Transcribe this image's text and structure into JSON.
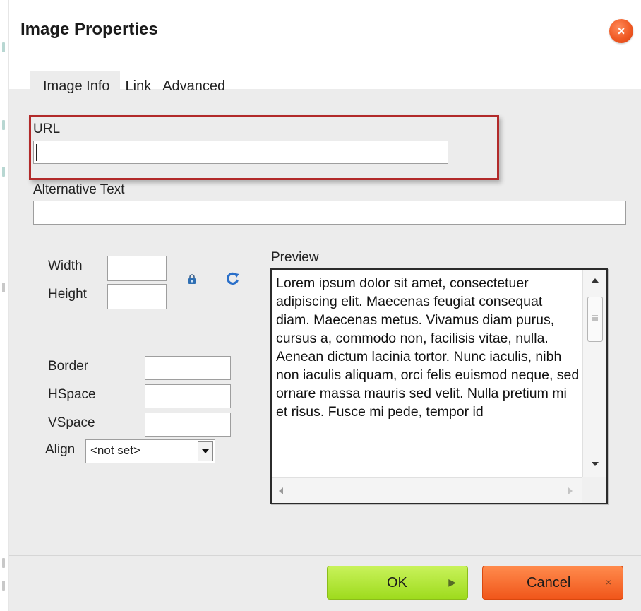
{
  "dialog": {
    "title": "Image Properties",
    "close_glyph": "×"
  },
  "tabs": [
    {
      "label": "Image Info",
      "active": true
    },
    {
      "label": "Link",
      "active": false
    },
    {
      "label": "Advanced",
      "active": false
    }
  ],
  "image_info": {
    "url_label": "URL",
    "url_value": "",
    "alt_label": "Alternative Text",
    "alt_value": "",
    "width_label": "Width",
    "width_value": "",
    "height_label": "Height",
    "height_value": "",
    "border_label": "Border",
    "border_value": "",
    "hspace_label": "HSpace",
    "hspace_value": "",
    "vspace_label": "VSpace",
    "vspace_value": "",
    "align_label": "Align",
    "align_selected": "<not set>",
    "preview_label": "Preview",
    "preview_text": "Lorem ipsum dolor sit amet, consectetuer adipiscing elit. Maecenas feugiat consequat diam. Maecenas metus. Vivamus diam purus, cursus a, commodo non, facilisis vitae, nulla. Aenean dictum lacinia tortor. Nunc iaculis, nibh non iaculis aliquam, orci felis euismod neque, sed ornare massa mauris sed velit. Nulla pretium mi et risus. Fusce mi pede, tempor id"
  },
  "footer": {
    "ok_label": "OK",
    "cancel_label": "Cancel",
    "ok_glyph": "▶",
    "cancel_glyph": "×"
  },
  "icons": {
    "lock": "lock-icon",
    "reset": "reset-size-icon",
    "close": "close-icon"
  },
  "colors": {
    "highlight": "#b22a2a",
    "ok": "#9edb1d",
    "cancel": "#f0561a",
    "close": "#f05a24"
  }
}
